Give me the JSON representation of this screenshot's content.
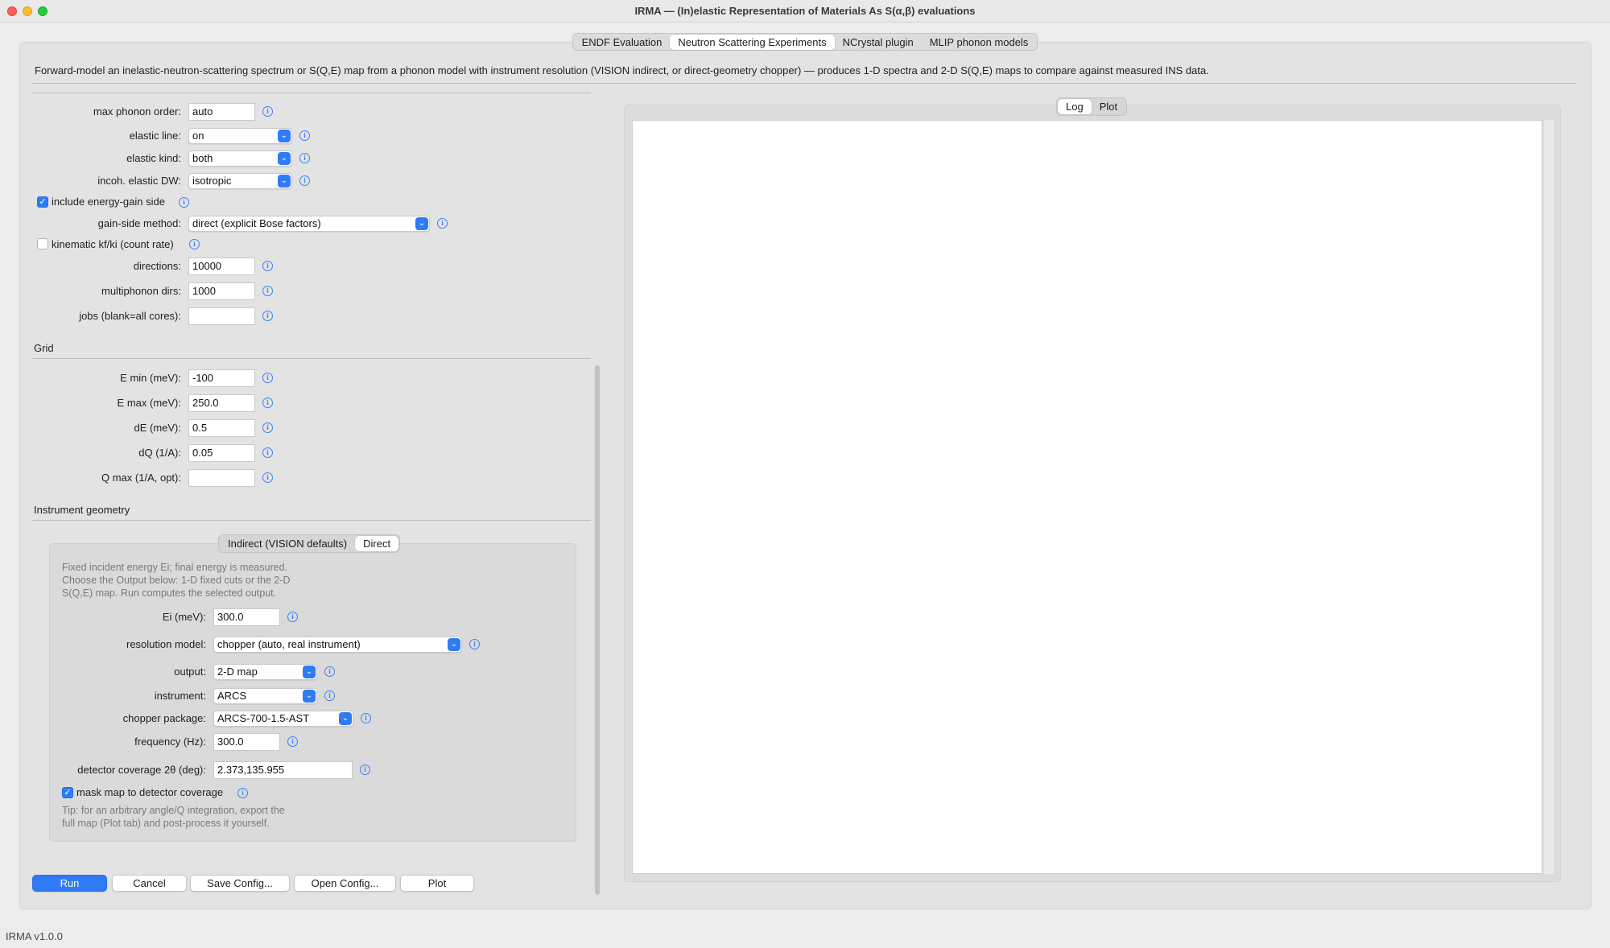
{
  "window": {
    "title": "IRMA — (In)elastic Representation of Materials As S(α,β) evaluations"
  },
  "tabs": [
    {
      "label": "ENDF Evaluation",
      "active": false
    },
    {
      "label": "Neutron Scattering Experiments",
      "active": true
    },
    {
      "label": "NCrystal plugin",
      "active": false
    },
    {
      "label": "MLIP phonon models",
      "active": false
    }
  ],
  "description": "Forward-model an inelastic-neutron-scattering spectrum or S(Q,E) map from a phonon model with instrument resolution (VISION indirect, or direct-geometry chopper) — produces 1-D spectra and 2-D S(Q,E) maps to compare against measured INS data.",
  "settings": {
    "max_phonon_order": {
      "label": "max phonon order:",
      "value": "auto"
    },
    "elastic_line": {
      "label": "elastic line:",
      "value": "on"
    },
    "elastic_kind": {
      "label": "elastic kind:",
      "value": "both"
    },
    "incoh_elastic_dw": {
      "label": "incoh. elastic DW:",
      "value": "isotropic"
    },
    "include_energy_gain": {
      "label": "include energy-gain side",
      "checked": true
    },
    "gain_side_method": {
      "label": "gain-side method:",
      "value": "direct (explicit Bose factors)"
    },
    "kinematic": {
      "label": "kinematic kf/ki (count rate)",
      "checked": false
    },
    "directions": {
      "label": "directions:",
      "value": "10000"
    },
    "multiphonon_dirs": {
      "label": "multiphonon dirs:",
      "value": "1000"
    },
    "jobs": {
      "label": "jobs (blank=all cores):",
      "value": ""
    }
  },
  "grid": {
    "title": "Grid",
    "e_min": {
      "label": "E min (meV):",
      "value": "-100"
    },
    "e_max": {
      "label": "E max (meV):",
      "value": "250.0"
    },
    "de": {
      "label": "dE (meV):",
      "value": "0.5"
    },
    "dq": {
      "label": "dQ (1/A):",
      "value": "0.05"
    },
    "q_max": {
      "label": "Q max (1/A, opt):",
      "value": ""
    }
  },
  "geometry": {
    "title": "Instrument geometry",
    "subtabs": [
      {
        "label": "Indirect (VISION defaults)",
        "active": false
      },
      {
        "label": "Direct",
        "active": true
      }
    ],
    "help_lines": [
      "Fixed incident energy Ei; final energy is measured.",
      "Choose the Output below: 1-D fixed cuts or the 2-D",
      "S(Q,E) map. Run computes the selected output."
    ],
    "ei": {
      "label": "Ei (meV):",
      "value": "300.0"
    },
    "resolution_model": {
      "label": "resolution model:",
      "value": "chopper (auto, real instrument)"
    },
    "output": {
      "label": "output:",
      "value": "2-D map"
    },
    "instrument": {
      "label": "instrument:",
      "value": "ARCS"
    },
    "chopper_package": {
      "label": "chopper package:",
      "value": "ARCS-700-1.5-AST"
    },
    "frequency": {
      "label": "frequency (Hz):",
      "value": "300.0"
    },
    "detector_coverage": {
      "label": "detector coverage 2θ (deg):",
      "value": "2.373,135.955"
    },
    "mask_map": {
      "label": "mask map to detector coverage",
      "checked": true
    },
    "tip_lines": [
      "Tip: for an arbitrary angle/Q integration, export the",
      "full map (Plot tab) and post-process it yourself."
    ]
  },
  "buttons": {
    "run": "Run",
    "cancel": "Cancel",
    "save": "Save Config...",
    "open": "Open Config...",
    "plot": "Plot"
  },
  "right_tabs": [
    {
      "label": "Log",
      "active": true
    },
    {
      "label": "Plot",
      "active": false
    }
  ],
  "info_glyph": "i",
  "chevron_glyph": "⌄",
  "check_glyph": "✓",
  "status": "IRMA v1.0.0",
  "colors": {
    "accent": "#2f7bf6",
    "info": "#3b82f6"
  }
}
